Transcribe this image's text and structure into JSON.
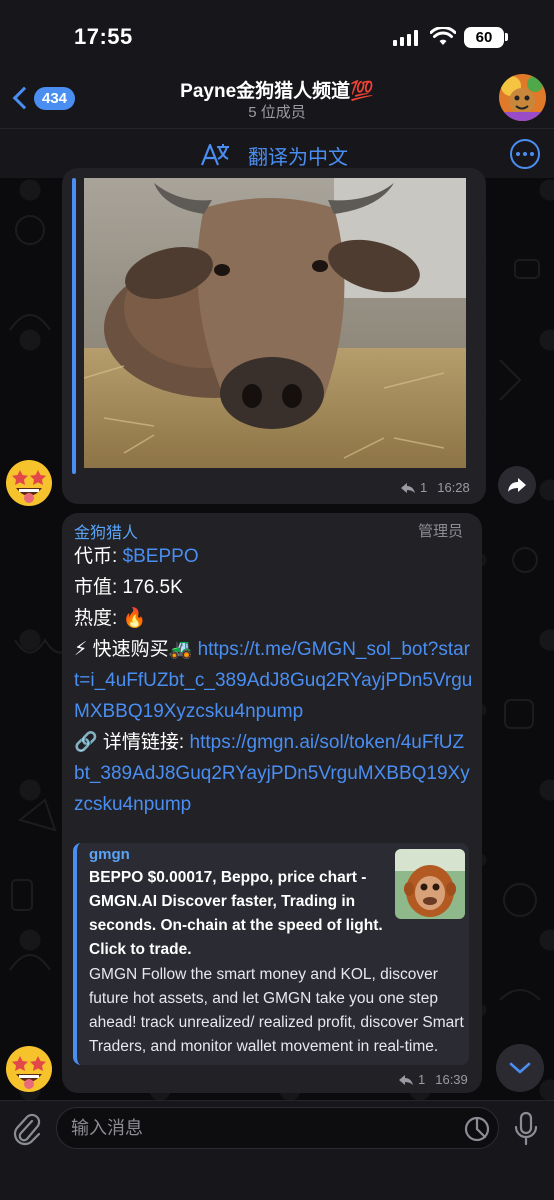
{
  "status_bar": {
    "time": "17:55",
    "battery": "60",
    "icons": [
      "signal-icon",
      "wifi-icon",
      "battery-icon"
    ]
  },
  "header": {
    "back_count": "434",
    "title": "Payne金狗猎人频道💯",
    "subtitle": "5 位成员"
  },
  "translate_bar": {
    "label": "翻译为中文",
    "icons": [
      "translate-icon",
      "more-icon"
    ]
  },
  "message1": {
    "forwards": "1",
    "time": "16:28",
    "icons": [
      "forward-count-icon",
      "share-icon"
    ]
  },
  "message2": {
    "sender": "金狗猎人",
    "role": "管理员",
    "line1_label": "代币: ",
    "line1_value": "$BEPPO",
    "line2": "市值: 176.5K",
    "line3_label": "热度: ",
    "line3_emoji": "🔥",
    "line4_prefix": "⚡ 快速购买🚜 ",
    "line4_link": "https://t.me/GMGN_sol_bot?start=i_4uFfUZbt_c_389AdJ8Guq2RYayjPDn5VrguMXBBQ19Xyzcsku4npump",
    "line5_prefix": "🔗 详情链接: ",
    "line5_link": "https://gmgn.ai/sol/token/4uFfUZbt_389AdJ8Guq2RYayjPDn5VrguMXBBQ19Xyzcsku4npump",
    "preview": {
      "site": "gmgn",
      "title": "BEPPO $0.00017, Beppo, price chart - GMGN.AI Discover faster, Trading in seconds. On-chain at the speed of light. Click to trade.",
      "description": "GMGN Follow the smart money and KOL, discover future hot assets, and let GMGN take you one step ahead! track unrealized/ realized profit, discover Smart Traders, and monitor wallet movement in real-time."
    },
    "forwards": "1",
    "time": "16:39"
  },
  "input_bar": {
    "placeholder": "输入消息",
    "icons": [
      "paperclip-icon",
      "sticker-icon",
      "microphone-icon"
    ]
  },
  "colors": {
    "accent": "#4a8ef2",
    "bubble": "#212126",
    "bar": "#17171b"
  }
}
